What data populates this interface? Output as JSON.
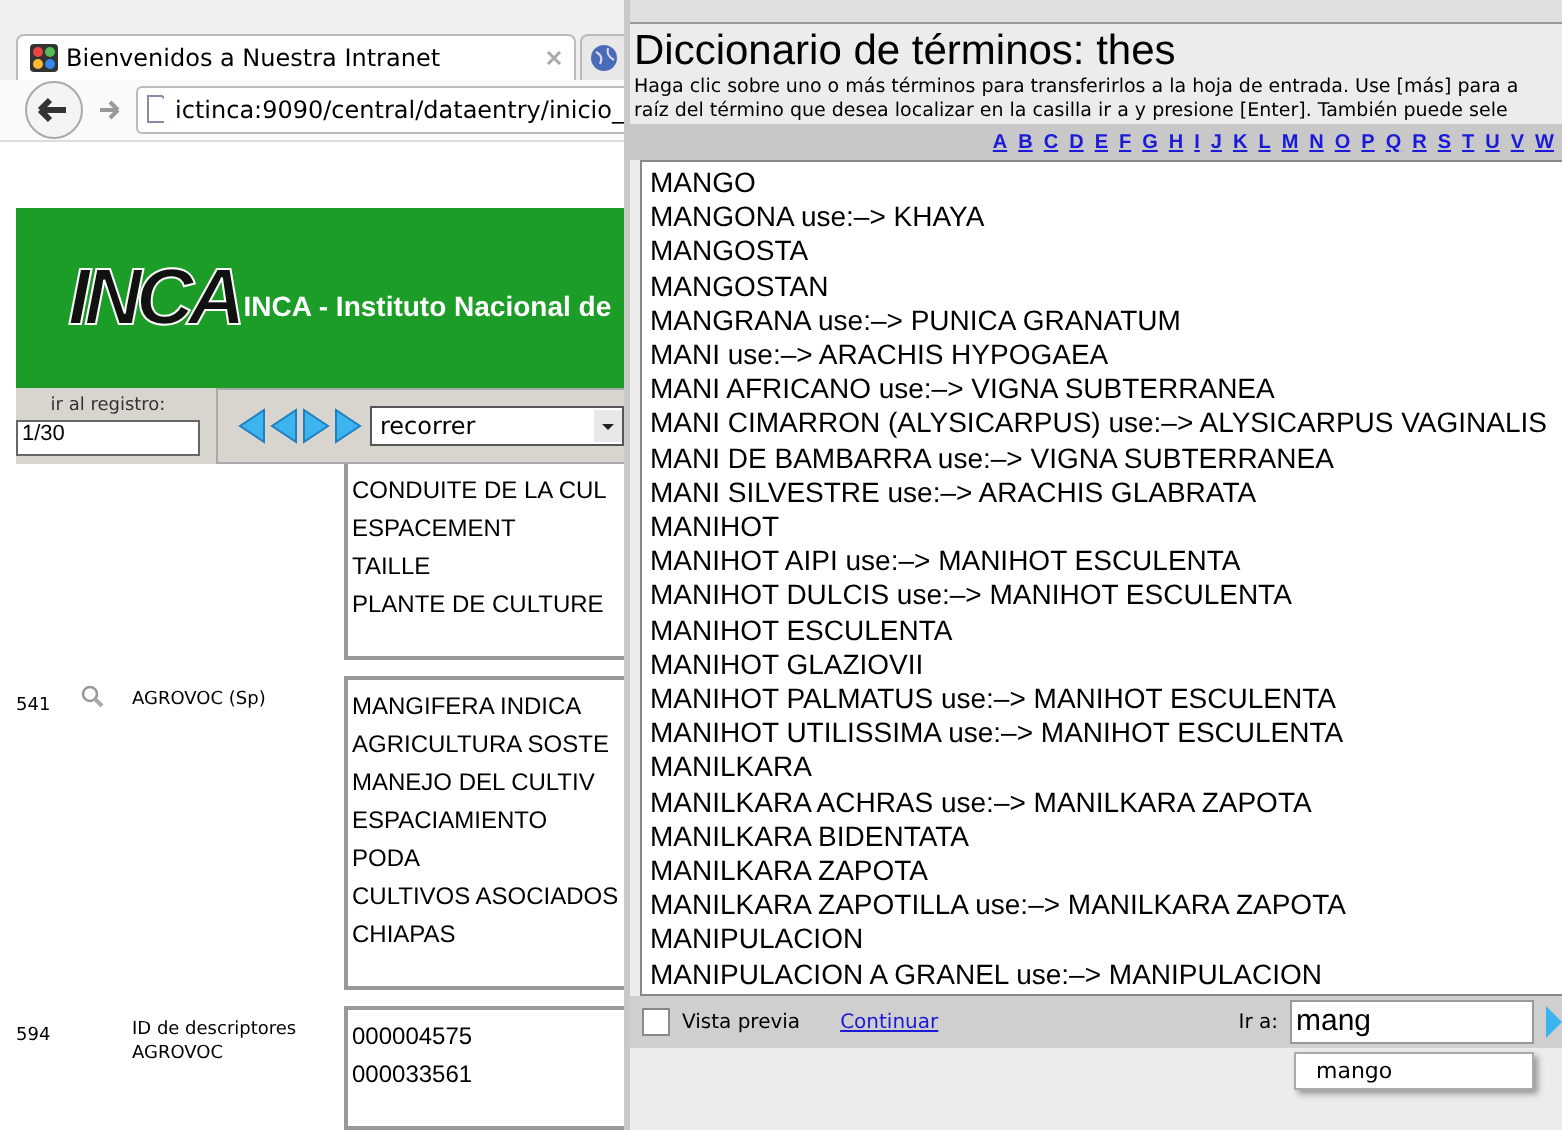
{
  "browser": {
    "tab": {
      "label": "Bienvenidos a Nuestra Intranet"
    },
    "url": "ictinca:9090/central/dataentry/inicio_",
    "banner": {
      "logo": "INCA",
      "title": "INCA - Instituto Nacional de"
    },
    "record_nav": {
      "label": "ir al registro:",
      "value": "1/30",
      "select": "recorrer"
    },
    "fields": [
      {
        "lines": [
          "CONDUITE DE LA CUL",
          "ESPACEMENT",
          "TAILLE",
          "PLANTE DE CULTURE"
        ]
      },
      {
        "tag": "541",
        "search": true,
        "label": "AGROVOC (Sp)",
        "lines": [
          "MANGIFERA INDICA",
          "AGRICULTURA SOSTE",
          "MANEJO DEL CULTIV",
          "ESPACIAMIENTO",
          "PODA",
          "CULTIVOS ASOCIADOS",
          "CHIAPAS"
        ]
      },
      {
        "tag": "594",
        "search": false,
        "label": "ID de descriptores AGROVOC",
        "lines": [
          "000004575",
          "000033561"
        ]
      }
    ]
  },
  "dialog": {
    "title": "Diccionario de términos: thes",
    "instructions": [
      "Haga clic sobre uno o más términos para transferirlos a la hoja de entrada. Use [más] para a",
      "raíz del término que desea localizar en la casilla ir a y presione [Enter]. También puede sele"
    ],
    "letters": [
      "A",
      "B",
      "C",
      "D",
      "E",
      "F",
      "G",
      "H",
      "I",
      "J",
      "K",
      "L",
      "M",
      "N",
      "O",
      "P",
      "Q",
      "R",
      "S",
      "T",
      "U",
      "V",
      "W"
    ],
    "terms": [
      "MANGO",
      "MANGONA use:–> KHAYA",
      "MANGOSTA",
      "MANGOSTAN",
      "MANGRANA use:–> PUNICA GRANATUM",
      "MANI use:–> ARACHIS HYPOGAEA",
      "MANI AFRICANO use:–> VIGNA SUBTERRANEA",
      "MANI CIMARRON (ALYSICARPUS) use:–> ALYSICARPUS VAGINALIS",
      "MANI DE BAMBARRA use:–> VIGNA SUBTERRANEA",
      "MANI SILVESTRE use:–> ARACHIS GLABRATA",
      "MANIHOT",
      "MANIHOT AIPI use:–> MANIHOT ESCULENTA",
      "MANIHOT DULCIS use:–> MANIHOT ESCULENTA",
      "MANIHOT ESCULENTA",
      "MANIHOT GLAZIOVII",
      "MANIHOT PALMATUS use:–> MANIHOT ESCULENTA",
      "MANIHOT UTILISSIMA use:–> MANIHOT ESCULENTA",
      "MANILKARA",
      "MANILKARA ACHRAS use:–> MANILKARA ZAPOTA",
      "MANILKARA BIDENTATA",
      "MANILKARA ZAPOTA",
      "MANILKARA ZAPOTILLA use:–> MANILKARA ZAPOTA",
      "MANIPULACION",
      "MANIPULACION A GRANEL use:–> MANIPULACION"
    ],
    "preview": {
      "label": "Vista previa",
      "checked": false
    },
    "link": "Continuar",
    "goto": {
      "label": "Ir a:",
      "value": "mang"
    },
    "suggestions": [
      "mango"
    ]
  }
}
